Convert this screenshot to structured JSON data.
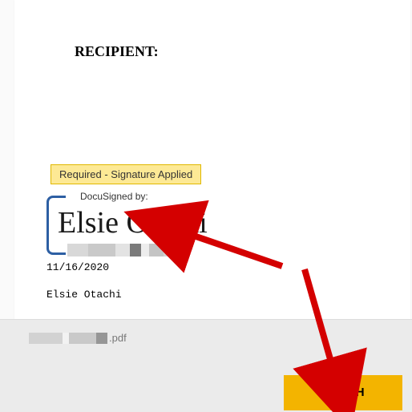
{
  "document": {
    "recipient_label": "RECIPIENT:",
    "tooltip": "Required - Signature Applied",
    "sig_top_label": "DocuSigned by:",
    "signature": "Elsie Otachi",
    "date": "11/16/2020",
    "name": "Elsie Otachi"
  },
  "toolbar": {
    "file_ext": ".pdf",
    "finish_label": "FINISH"
  },
  "colors": {
    "finish_bg": "#f3b400",
    "tooltip_bg": "#fde995",
    "bracket": "#2d5fa3",
    "arrow": "#d40000"
  }
}
